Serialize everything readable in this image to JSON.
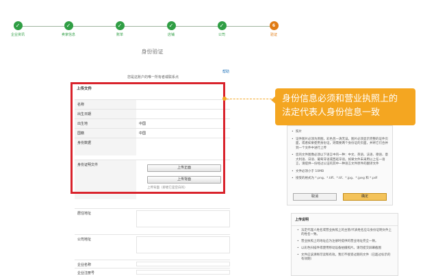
{
  "steps": [
    {
      "label": "企业资讯",
      "done": true
    },
    {
      "label": "卖家信息",
      "done": true
    },
    {
      "label": "账单",
      "done": true
    },
    {
      "label": "店铺",
      "done": true
    },
    {
      "label": "公司",
      "done": true
    },
    {
      "label": "验证",
      "done": false,
      "number": "6"
    }
  ],
  "page_title": "身份验证",
  "help_link": "帮助",
  "notice": "您是这账户的唯一所有者或联系点",
  "section_title": "上传文件",
  "fields": [
    {
      "label": "名称",
      "value": ""
    },
    {
      "label": "出生日期",
      "value": ""
    },
    {
      "label": "出生地",
      "value": "中国"
    },
    {
      "label": "国籍",
      "value": "中国"
    },
    {
      "label": "身份数据",
      "value": ""
    }
  ],
  "id_docs_label": "身份证明文件",
  "upload_front": "上传正面",
  "upload_back": "上传背面",
  "upload_hint": "上传背面（即者它是空白的）",
  "residence_label": "居住地址",
  "company_address_label": "公司地址",
  "company_name_label": "企业名称",
  "company_reg_label": "企业注册号",
  "callout_text": [
    "身份信息必须和营业执照上的",
    "法定代表人身份信息一致"
  ],
  "right_panel": {
    "bullets": [
      "照片",
      "证件图片必须为原图，彩色且一清无误。图片必须显示完整的证件页面，或者如果使用身份证，则需要两个身份证的页面，并将它们合并到一个文件中进行上传",
      "您的文件图像必须以下语言中的一种：中文、英语、法语、德语、意大利语、日语、葡萄牙语或西班牙语。如果文件未采用以上任一语言，请提供一份经过公证的其中一种语言文件原件的翻译文件",
      "文件必须小于 10MB",
      "接受的格式为 *.png、*.tiff、*.tif、*.jpg、*.jpeg 和 *.pdf"
    ],
    "cancel_label": "取消",
    "confirm_label": "确定"
  },
  "upload_panel": {
    "title": "上传说明",
    "bullets": [
      "法定代理人姓名或营业执照上的主管/代表姓名应与身份证明文件上的姓名一致。",
      "营业执照上的地址应为注册时提供的营业地址完全一致。",
      "以彩色扫描件或使用移动设备拍摄照片。请勿提交屏幕截图",
      "文件应该清晰可读和有效。我们不接受过期的文件（已超过标示的有效期）"
    ]
  },
  "colors": {
    "step_done": "#2f9e44",
    "step_current": "#e07b14",
    "highlight": "#d9232c",
    "callout": "#f4a621"
  }
}
